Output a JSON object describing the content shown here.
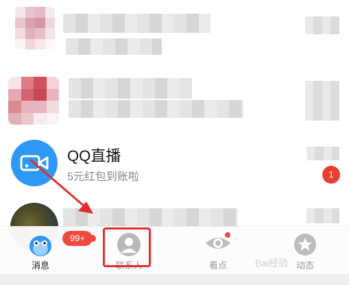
{
  "conversations": [
    {
      "kind": "blurred"
    },
    {
      "kind": "blurred"
    },
    {
      "kind": "service",
      "title": "QQ直播",
      "preview": "5元红包到账啦",
      "unread": "1"
    },
    {
      "kind": "blurred"
    }
  ],
  "tabbar": {
    "tabs": [
      {
        "id": "messages",
        "label": "消息",
        "badge": "99+",
        "active": true
      },
      {
        "id": "contacts",
        "label": "联系人",
        "active": false
      },
      {
        "id": "kandian",
        "label": "看点",
        "active": false
      },
      {
        "id": "dongtai",
        "label": "动态",
        "active": false
      }
    ]
  },
  "watermark": "Bai经验",
  "colors": {
    "accent": "#2f98f5",
    "badge": "#e93f2f",
    "annotation": "#e22d2d"
  }
}
